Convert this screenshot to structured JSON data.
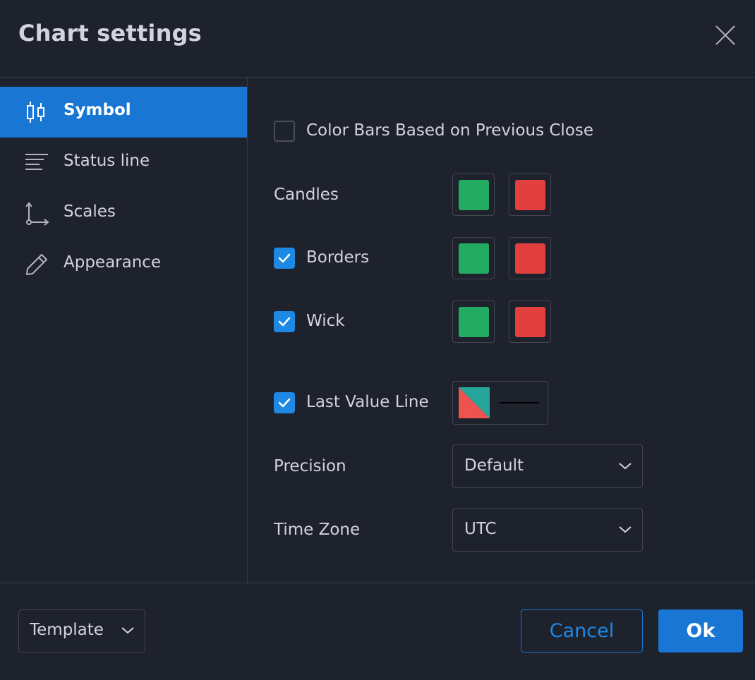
{
  "dialog": {
    "title": "Chart settings"
  },
  "sidebar": {
    "items": [
      {
        "label": "Symbol",
        "icon": "candles-icon",
        "active": true
      },
      {
        "label": "Status line",
        "icon": "status-line-icon",
        "active": false
      },
      {
        "label": "Scales",
        "icon": "scales-icon",
        "active": false
      },
      {
        "label": "Appearance",
        "icon": "pencil-icon",
        "active": false
      }
    ]
  },
  "symbol": {
    "color_bars_label": "Color Bars Based on Previous Close",
    "color_bars_checked": false,
    "candles_label": "Candles",
    "borders_label": "Borders",
    "borders_checked": true,
    "wick_label": "Wick",
    "wick_checked": true,
    "last_value_line_label": "Last Value Line",
    "last_value_line_checked": true,
    "precision_label": "Precision",
    "precision_value": "Default",
    "timezone_label": "Time Zone",
    "timezone_value": "UTC"
  },
  "colors": {
    "up": "#22ab61",
    "down": "#e1403f",
    "accent": "#1976d2",
    "lvl_teal": "#26a69a",
    "lvl_red": "#ef5350"
  },
  "footer": {
    "template_label": "Template",
    "cancel_label": "Cancel",
    "ok_label": "Ok"
  }
}
